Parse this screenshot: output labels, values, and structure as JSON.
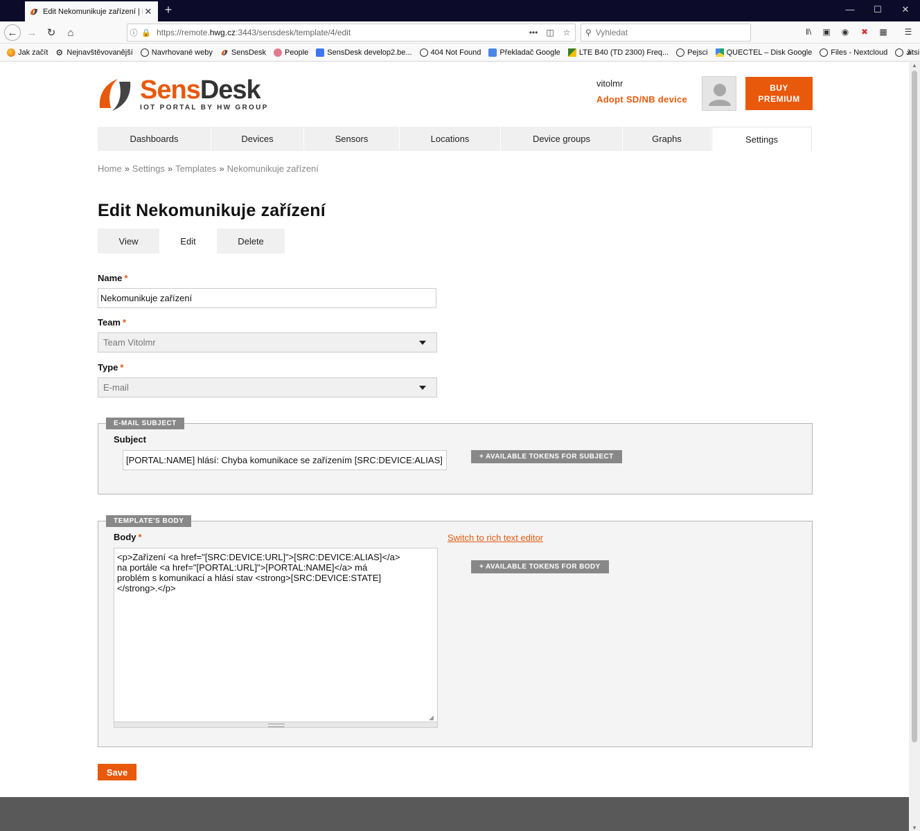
{
  "browser": {
    "tab_title": "Edit Nekomunikuje zařízení | Po",
    "url_prefix": "https://remote.",
    "url_host": "hwg.cz",
    "url_rest": ":3443/sensdesk/template/4/edit",
    "search_placeholder": "Vyhledat",
    "bookmarks": [
      {
        "label": "Jak začít",
        "icon": "firefox-icon"
      },
      {
        "label": "Nejnavštěvovanější",
        "icon": "gear-icon"
      },
      {
        "label": "Navrhované weby",
        "icon": "globe-icon"
      },
      {
        "label": "SensDesk",
        "icon": "sensdesk-icon"
      },
      {
        "label": "People",
        "icon": "people-icon"
      },
      {
        "label": "SensDesk develop2.be...",
        "icon": "doc-icon"
      },
      {
        "label": "404 Not Found",
        "icon": "globe-icon"
      },
      {
        "label": "Překladač Google",
        "icon": "translate-icon"
      },
      {
        "label": "LTE B40 (TD 2300) Freq...",
        "icon": "lte-icon"
      },
      {
        "label": "Pejsci",
        "icon": "globe-icon"
      },
      {
        "label": "QUECTEL – Disk Google",
        "icon": "drive-icon"
      },
      {
        "label": "Files - Nextcloud",
        "icon": "globe-icon"
      },
      {
        "label": "Jitsi Meet",
        "icon": "globe-icon"
      }
    ]
  },
  "header": {
    "logo_main": "Sens",
    "logo_accent": "Desk",
    "logo_sub": "IOT PORTAL BY HW GROUP",
    "username": "vitolmr",
    "adopt_link": "Adopt SD/NB device",
    "buy_button": "BUY\nPREMIUM"
  },
  "nav": {
    "items": [
      {
        "label": "Dashboards",
        "active": false
      },
      {
        "label": "Devices",
        "active": false
      },
      {
        "label": "Sensors",
        "active": false
      },
      {
        "label": "Locations",
        "active": false
      },
      {
        "label": "Device groups",
        "active": false
      },
      {
        "label": "Graphs",
        "active": false
      },
      {
        "label": "Settings",
        "active": true
      }
    ]
  },
  "breadcrumb": {
    "items": [
      "Home",
      "Settings",
      "Templates",
      "Nekomunikuje zařízení"
    ],
    "separator": "»"
  },
  "page": {
    "title": "Edit Nekomunikuje zařízení",
    "tabs": [
      {
        "label": "View",
        "active": false
      },
      {
        "label": "Edit",
        "active": true
      },
      {
        "label": "Delete",
        "active": false
      }
    ]
  },
  "form": {
    "required_mark": "*",
    "name_label": "Name",
    "name_value": "Nekomunikuje zařízení",
    "team_label": "Team",
    "team_value": "Team Vitolmr",
    "type_label": "Type",
    "type_value": "E-mail",
    "subject_legend": "E-MAIL SUBJECT",
    "subject_label": "Subject",
    "subject_value": "[PORTAL:NAME] hlásí: Chyba komunikace se zařízením [SRC:DEVICE:ALIAS]",
    "subject_tokens_button": "+ AVAILABLE TOKENS FOR SUBJECT",
    "body_legend": "TEMPLATE'S BODY",
    "body_label": "Body",
    "rich_text_link": "Switch to rich text editor",
    "body_value": "<p>Zařízení <a href=\"[SRC:DEVICE:URL]\">[SRC:DEVICE:ALIAS]</a>\nna portále <a href=\"[PORTAL:URL]\">[PORTAL:NAME]</a> má\nproblém s komunikací a hlásí stav <strong>[SRC:DEVICE:STATE]\n</strong>.</p>",
    "body_tokens_button": "+ AVAILABLE TOKENS FOR BODY",
    "save_button": "Save"
  },
  "colors": {
    "accent": "#e8590c",
    "nav_bg": "#f0f0f0",
    "legend_bg": "#888888",
    "footer": "#595959"
  }
}
